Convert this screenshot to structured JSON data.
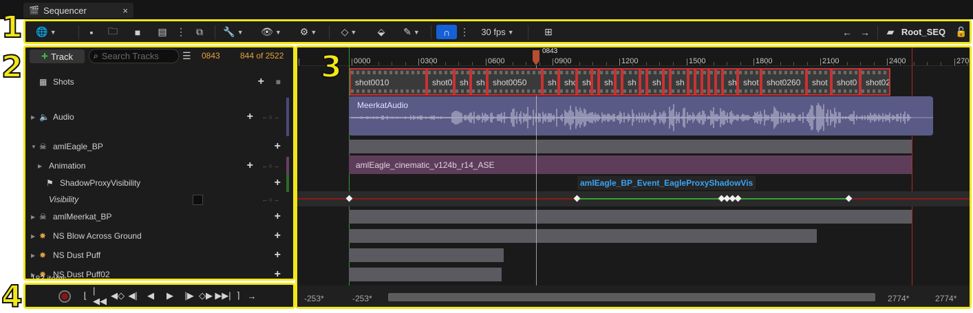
{
  "tab": {
    "title": "Sequencer",
    "close": "×"
  },
  "toolbar": {
    "fps": "30 fps",
    "root_seq": "Root_SEQ"
  },
  "tracks_panel": {
    "add_track_label": "Track",
    "search_placeholder": "Search Tracks",
    "current_frame": "0843",
    "frame_count": "844 of 2522",
    "items_count": "183 items",
    "rows": [
      {
        "label": "Shots"
      },
      {
        "label": "Audio"
      },
      {
        "label": "amlEagle_BP"
      },
      {
        "label": "Animation"
      },
      {
        "label": "ShadowProxyVisibility"
      },
      {
        "label": "Visibility"
      },
      {
        "label": "amlMeerkat_BP"
      },
      {
        "label": "NS Blow Across Ground"
      },
      {
        "label": "NS Dust Puff"
      },
      {
        "label": "NS Dust Puff02"
      }
    ]
  },
  "timeline": {
    "ruler_labels": [
      "0000",
      "0300",
      "0600",
      "0900",
      "1200",
      "1500",
      "1800",
      "2100",
      "2400",
      "270"
    ],
    "playhead": "0843",
    "shots": [
      {
        "name": "shot0010"
      },
      {
        "name": "shot0"
      },
      {
        "name": "sh"
      },
      {
        "name": "sh"
      },
      {
        "name": "shot0050"
      },
      {
        "name": "sh"
      },
      {
        "name": "sho"
      },
      {
        "name": "sh"
      },
      {
        "name": ""
      },
      {
        "name": "sh"
      },
      {
        "name": ""
      },
      {
        "name": "sh"
      },
      {
        "name": "s"
      },
      {
        "name": "sh"
      },
      {
        "name": ""
      },
      {
        "name": "sh"
      },
      {
        "name": "s"
      },
      {
        "name": ""
      },
      {
        "name": ""
      },
      {
        "name": ""
      },
      {
        "name": ""
      },
      {
        "name": "sh"
      },
      {
        "name": "shot"
      },
      {
        "name": "shot0260"
      },
      {
        "name": "shot"
      },
      {
        "name": "shot0"
      },
      {
        "name": "shot02"
      }
    ],
    "audio_clip": "MeerkatAudio",
    "anim_clip": "amlEagle_cinematic_v124b_r14_ASE",
    "event_label": "amlEagle_BP_Event_EagleProxyShadowVis",
    "range_start_outer": "-253*",
    "range_start_inner": "-253*",
    "range_end_inner": "2774*",
    "range_end_outer": "2774*"
  },
  "annotations": {
    "n1": "1",
    "n2": "2",
    "n3": "3",
    "n4": "4"
  },
  "colors": {
    "highlight": "#f2e61a",
    "shot_border": "#c83232",
    "accent_blue": "#1560d6",
    "frame_orange": "#e8a23c"
  }
}
